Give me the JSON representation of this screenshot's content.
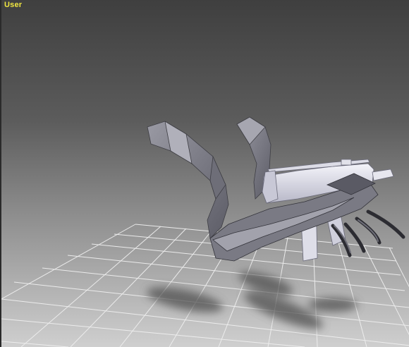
{
  "viewport": {
    "label": "User",
    "label_color": "#f0e640",
    "background_top": "#3f3f3f",
    "background_bottom": "#cfcfcf"
  },
  "scene": {
    "grid_color": "#f2f2f2",
    "model_color": "#8c8c94",
    "weapon_color": "#e8e8f0",
    "shadow_color": "#555555"
  }
}
